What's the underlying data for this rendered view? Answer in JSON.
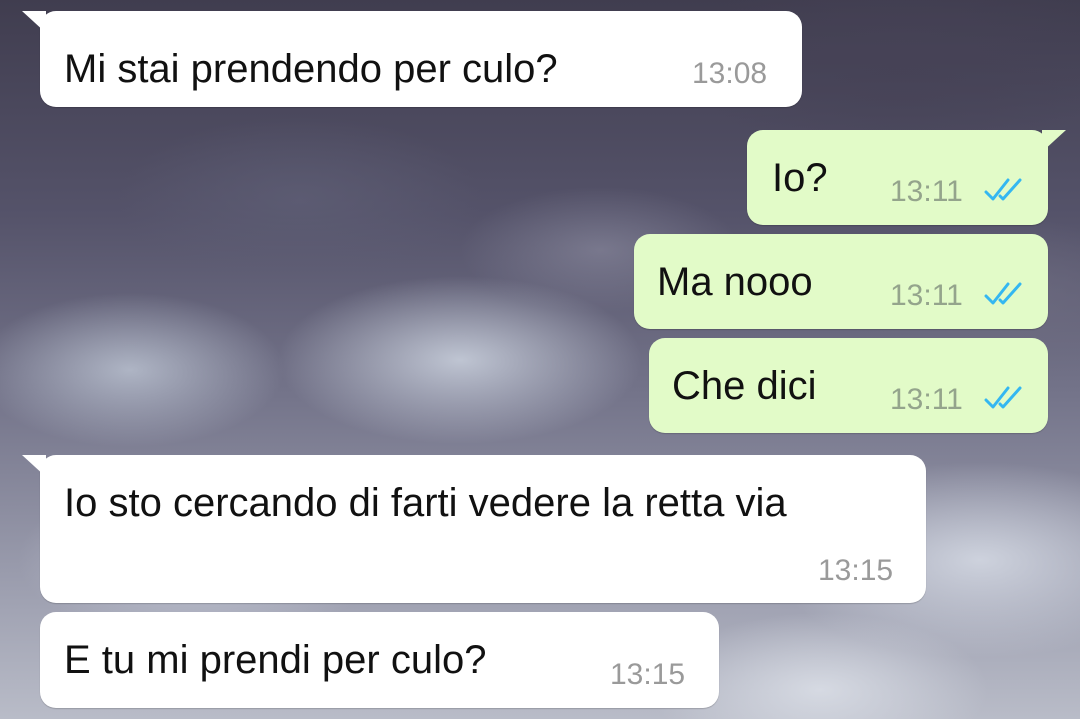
{
  "chat": {
    "messages": [
      {
        "direction": "incoming",
        "text": "Mi stai prendendo per culo?",
        "time": "13:08"
      },
      {
        "direction": "outgoing",
        "text": "Io?",
        "time": "13:11",
        "status": "read"
      },
      {
        "direction": "outgoing",
        "text": "Ma nooo",
        "time": "13:11",
        "status": "read"
      },
      {
        "direction": "outgoing",
        "text": "Che dici",
        "time": "13:11",
        "status": "read"
      },
      {
        "direction": "incoming",
        "text": "Io sto cercando di farti vedere la retta via",
        "time": "13:15"
      },
      {
        "direction": "incoming",
        "text": "E tu mi prendi per culo?",
        "time": "13:15"
      }
    ]
  },
  "colors": {
    "incoming_bubble": "#ffffff",
    "outgoing_bubble": "#e2fbc8",
    "read_ticks": "#34b7f1",
    "timestamp": "#9a9a9a"
  },
  "icons": {
    "read_receipt": "double-check-icon"
  }
}
